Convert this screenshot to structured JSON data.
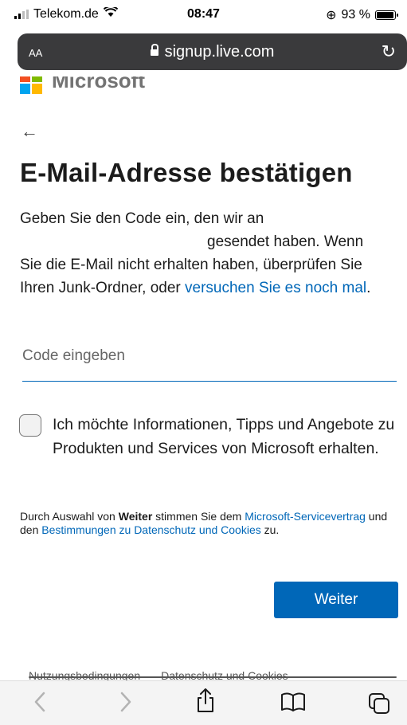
{
  "status_bar": {
    "carrier": "Telekom.de",
    "time": "08:47",
    "battery": "93 %"
  },
  "browser": {
    "text_size_label": "AA",
    "url": "signup.live.com"
  },
  "brand": {
    "name": "Microsoft"
  },
  "page": {
    "title": "E-Mail-Adresse bestätigen",
    "desc_line1": "Geben Sie den Code ein, den wir an",
    "desc_line2": "gesendet haben. Wenn",
    "desc_rest": "Sie die E-Mail nicht erhalten haben, überprüfen Sie Ihren Junk-Ordner, oder ",
    "retry_link": "versuchen Sie es noch mal",
    "desc_end": ".",
    "code_placeholder": "Code eingeben",
    "checkbox_label": "Ich möchte Informationen, Tipps und Angebote zu Produkten und Services von Microsoft erhalten.",
    "legal_pre": "Durch Auswahl von ",
    "legal_bold": "Weiter",
    "legal_mid1": " stimmen Sie dem ",
    "legal_link1": "Microsoft-Servicevertrag",
    "legal_mid2": " und den ",
    "legal_link2": "Bestimmungen zu Datenschutz und Cookies",
    "legal_end": " zu.",
    "next_button": "Weiter"
  },
  "footer": {
    "terms": "Nutzungsbedingungen",
    "privacy": "Datenschutz und Cookies"
  },
  "toolbar": {
    "back": "‹",
    "forward": "›",
    "share": "⇪",
    "bookmarks": "📖",
    "tabs": "⧉"
  },
  "colors": {
    "accent": "#0067b8",
    "ms_red": "#f25022",
    "ms_green": "#7fba00",
    "ms_blue": "#00a4ef",
    "ms_yellow": "#ffb900"
  }
}
